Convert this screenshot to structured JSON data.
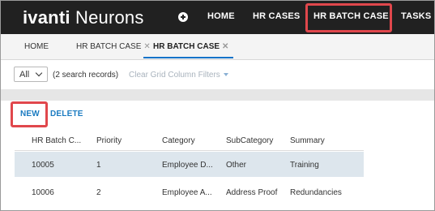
{
  "header": {
    "brand_bold": "ivanti",
    "brand_rest": " Neurons",
    "nav": [
      {
        "label": "HOME"
      },
      {
        "label": "HR CASES"
      },
      {
        "label": "HR BATCH CASE"
      },
      {
        "label": "TASKS"
      }
    ]
  },
  "tabs": [
    {
      "label": "HOME",
      "close": ""
    },
    {
      "label": "HR BATCH CASE",
      "close": "✕"
    },
    {
      "label": "HR BATCH CASE",
      "close": "✕"
    }
  ],
  "filters": {
    "select_value": "All",
    "records_text": "(2 search records)",
    "clear_filters": "Clear Grid Column Filters"
  },
  "actions": {
    "new_label": "NEW",
    "delete_label": "DELETE"
  },
  "table": {
    "columns": [
      "HR Batch C...",
      "Priority",
      "Category",
      "SubCategory",
      "Summary"
    ],
    "rows": [
      [
        "10005",
        "1",
        "Employee D...",
        "Other",
        "Training"
      ],
      [
        "10006",
        "2",
        "Employee A...",
        "Address Proof",
        "Redundancies"
      ]
    ]
  },
  "colors": {
    "header_bg": "#212121",
    "accent": "#1473c9",
    "highlight": "#e0474c",
    "selected_row": "#dde6ed"
  }
}
